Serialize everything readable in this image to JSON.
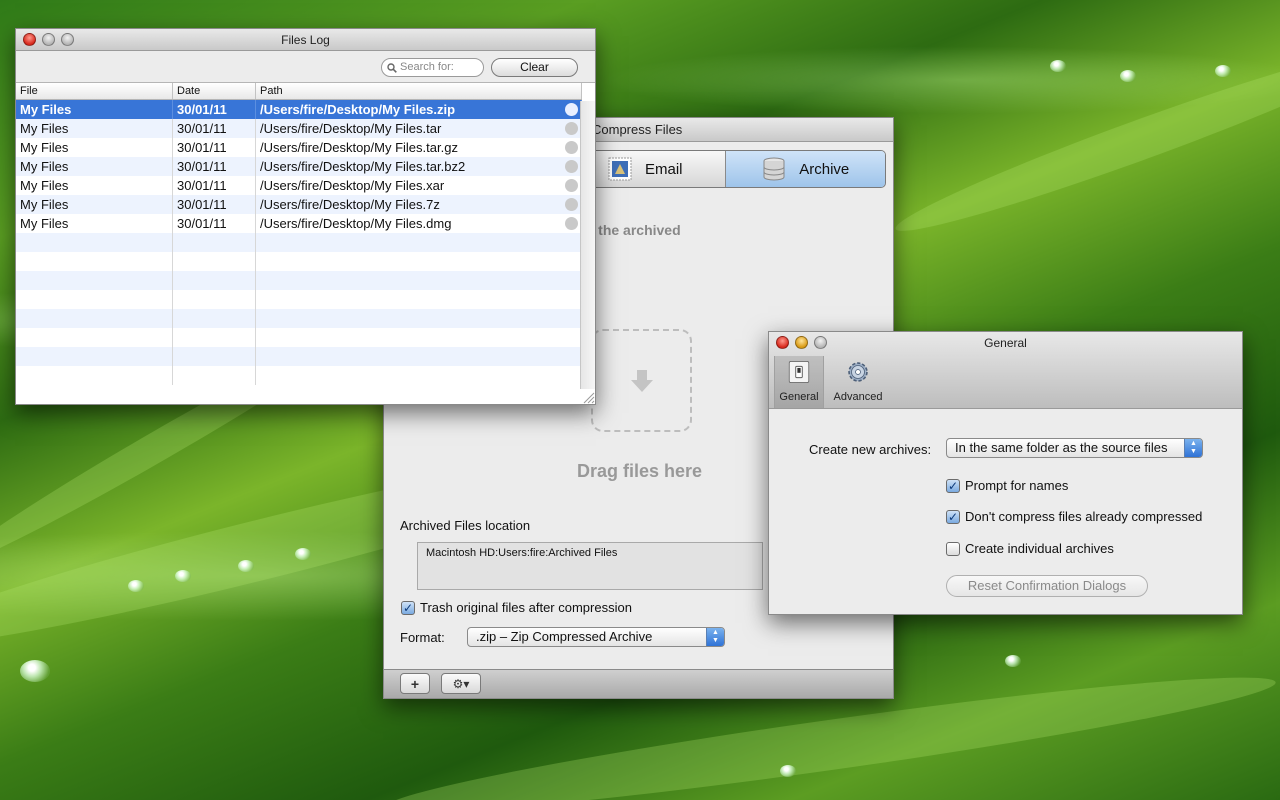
{
  "files_log": {
    "title": "Files Log",
    "search_placeholder": "Search for:",
    "clear_label": "Clear",
    "columns": [
      "File",
      "Date",
      "Path"
    ],
    "rows": [
      {
        "file": "My Files",
        "date": "30/01/11",
        "path": "/Users/fire/Desktop/My Files.zip",
        "selected": true
      },
      {
        "file": "My Files",
        "date": "30/01/11",
        "path": "/Users/fire/Desktop/My Files.tar"
      },
      {
        "file": "My Files",
        "date": "30/01/11",
        "path": "/Users/fire/Desktop/My Files.tar.gz"
      },
      {
        "file": "My Files",
        "date": "30/01/11",
        "path": "/Users/fire/Desktop/My Files.tar.bz2"
      },
      {
        "file": "My Files",
        "date": "30/01/11",
        "path": "/Users/fire/Desktop/My Files.xar"
      },
      {
        "file": "My Files",
        "date": "30/01/11",
        "path": "/Users/fire/Desktop/My Files.7z"
      },
      {
        "file": "My Files",
        "date": "30/01/11",
        "path": "/Users/fire/Desktop/My Files.dmg"
      }
    ]
  },
  "compress": {
    "title": "Compress Files",
    "tabs": {
      "email": {
        "label": "Email",
        "icon": "stamp-icon"
      },
      "archive": {
        "label": "Archive",
        "icon": "database-icon",
        "active": true
      }
    },
    "instruction": "Compress your files into an archive, then put it into the archived",
    "drag_label": "Drag files here",
    "location_label": "Archived Files location",
    "location_value": "Macintosh HD:Users:fire:Archived Files",
    "trash_label": "Trash original files after compression",
    "trash_checked": true,
    "format_label": "Format:",
    "format_value": ".zip – Zip Compressed Archive",
    "add_label": "+",
    "gear_label": "⚙▾"
  },
  "general": {
    "title": "General",
    "toolbar": [
      {
        "label": "General",
        "icon": "switch-icon",
        "active": true
      },
      {
        "label": "Advanced",
        "icon": "gear-icon"
      }
    ],
    "create_label": "Create new archives:",
    "create_value": "In the same folder as the source files",
    "options": [
      {
        "label": "Prompt for names",
        "checked": true
      },
      {
        "label": "Don't compress files already compressed",
        "checked": true
      },
      {
        "label": "Create individual archives",
        "checked": false
      }
    ],
    "reset_label": "Reset Confirmation Dialogs"
  },
  "colors": {
    "selection": "#3875d7",
    "stripe": "#edf3fe",
    "tab_active": "#9ec4ea"
  }
}
